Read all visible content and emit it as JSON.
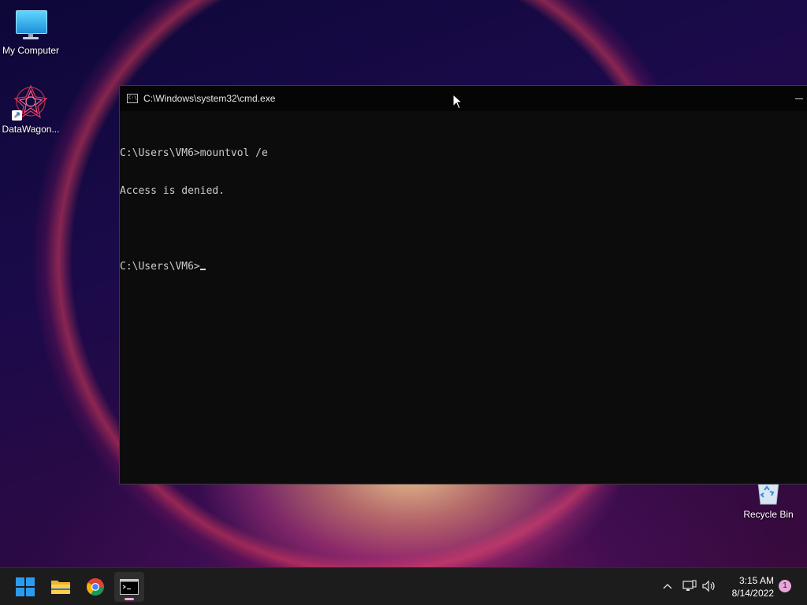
{
  "desktop": {
    "icons": [
      {
        "label": "My Computer"
      },
      {
        "label": "DataWagon..."
      },
      {
        "label": "Recycle Bin"
      }
    ]
  },
  "cmd_window": {
    "title": "C:\\Windows\\system32\\cmd.exe",
    "lines": [
      "C:\\Users\\VM6>mountvol /e",
      "Access is denied.",
      "",
      "C:\\Users\\VM6>"
    ]
  },
  "taskbar": {
    "apps": [
      {
        "name": "start-button",
        "icon": "windows-logo-icon"
      },
      {
        "name": "file-explorer",
        "icon": "folder-icon"
      },
      {
        "name": "chrome",
        "icon": "chrome-icon"
      },
      {
        "name": "command-prompt",
        "icon": "terminal-icon",
        "active": true
      }
    ],
    "clock": {
      "time": "3:15 AM",
      "date": "8/14/2022"
    },
    "notification_count": "1"
  },
  "colors": {
    "terminal_bg": "#0c0c0c",
    "terminal_text": "#cccccc",
    "taskbar_bg": "#1c1c1c",
    "accent": "#e8a6d8"
  }
}
